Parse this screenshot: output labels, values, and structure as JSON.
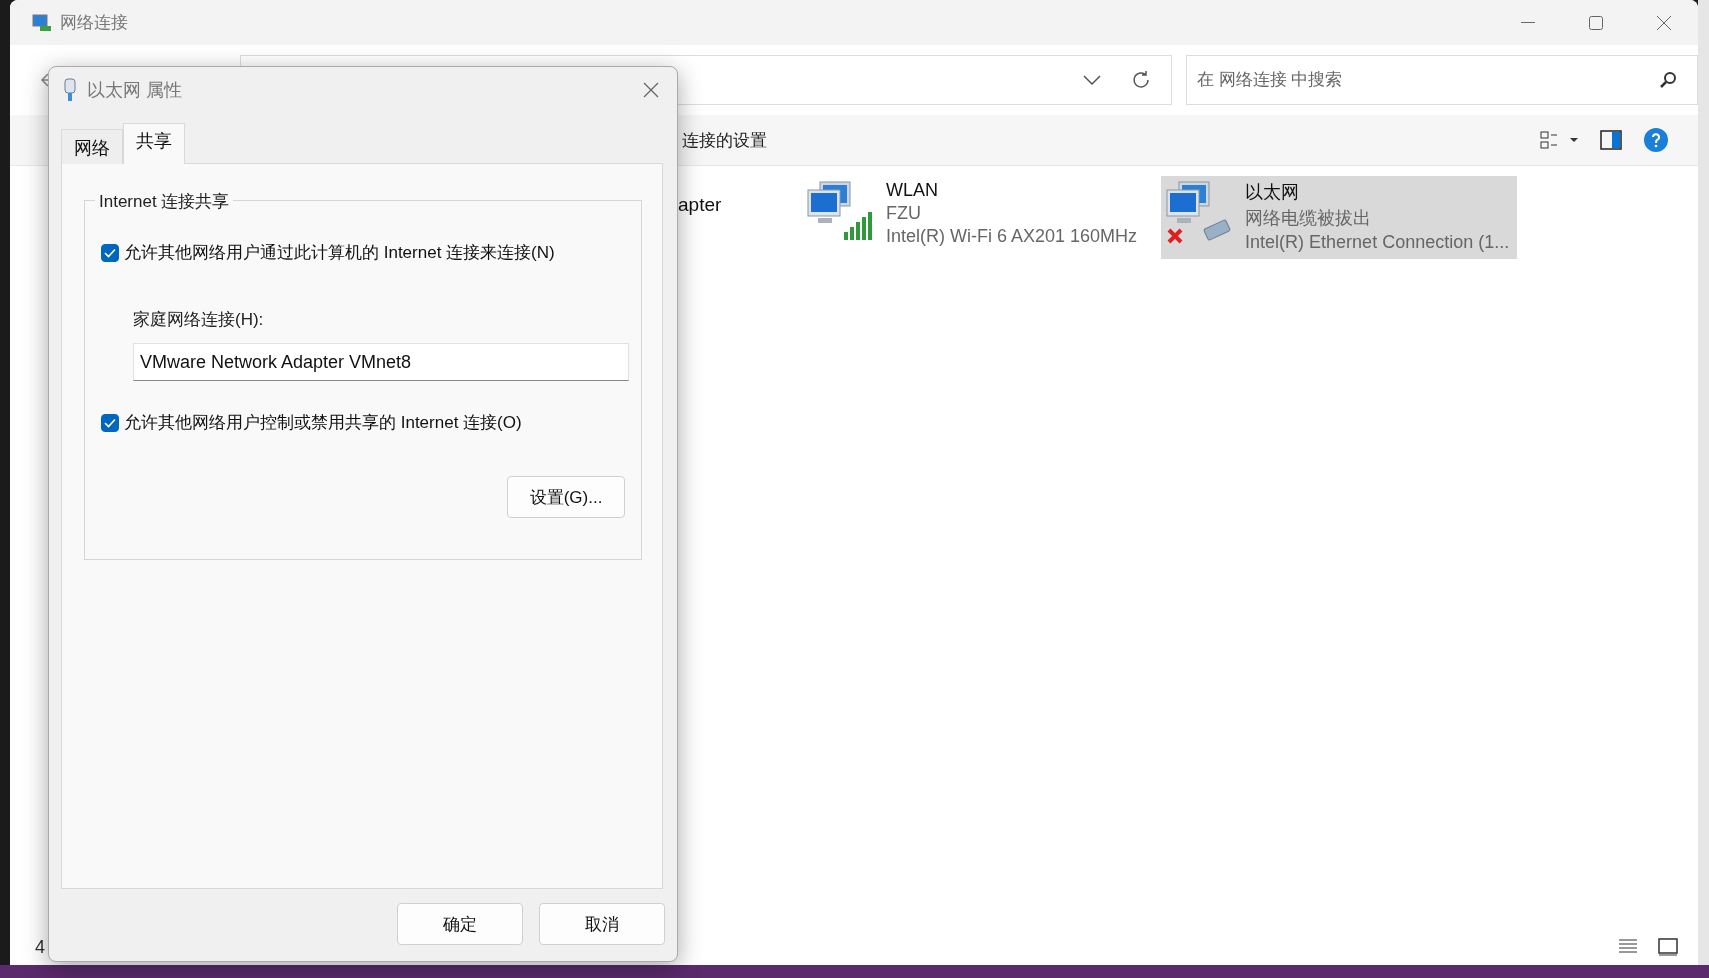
{
  "window": {
    "title": "网络连接",
    "search": {
      "placeholder": "在 网络连接 中搜索"
    },
    "command_bar": {
      "item": "连接的设置"
    },
    "connections": [
      {
        "kind": "partial",
        "name": "apter"
      },
      {
        "kind": "wifi",
        "name": "WLAN",
        "status": "FZU",
        "device": "Intel(R) Wi-Fi 6 AX201 160MHz",
        "selected": false,
        "disconnected": false
      },
      {
        "kind": "ethernet",
        "name": "以太网",
        "status": "网络电缆被拔出",
        "device": "Intel(R) Ethernet Connection (1...",
        "selected": true,
        "disconnected": true
      }
    ],
    "status_bar": {
      "count": "4"
    }
  },
  "dialog": {
    "title": "以太网 属性",
    "tabs": [
      {
        "label": "网络",
        "selected": false
      },
      {
        "label": "共享",
        "selected": true
      }
    ],
    "group": {
      "legend": "Internet 连接共享",
      "allow_sharing": {
        "label": "允许其他网络用户通过此计算机的 Internet 连接来连接(N)",
        "checked": true
      },
      "home_label": "家庭网络连接(H):",
      "home_value": "VMware Network Adapter VMnet8",
      "allow_control": {
        "label": "允许其他网络用户控制或禁用共享的 Internet 连接(O)",
        "checked": true
      },
      "settings_button": "设置(G)..."
    },
    "buttons": [
      "确定",
      "取消"
    ]
  }
}
